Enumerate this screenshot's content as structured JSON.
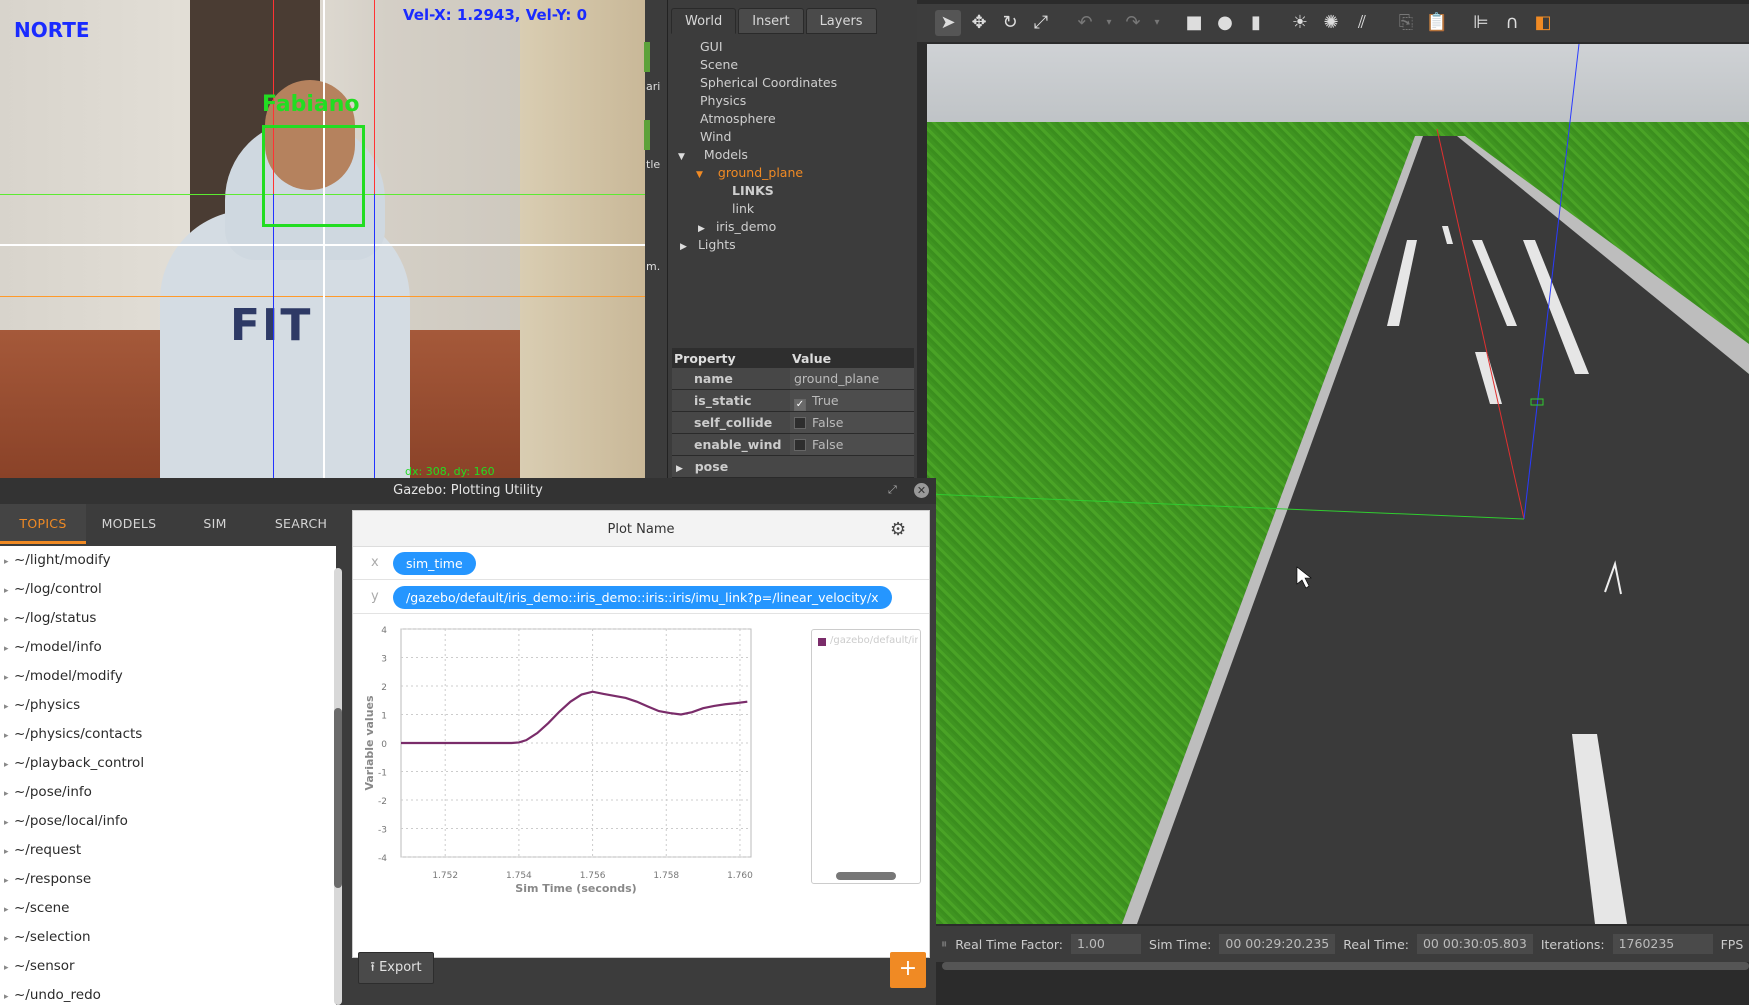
{
  "camera": {
    "overlay_label": "NORTE",
    "velocity_readout": "Vel-X: 1.2943, Vel-Y: 0",
    "face_label": "Fabiano",
    "shirt_print": "FIT",
    "offset_readout": "dx: 308, dy: 160"
  },
  "sliver": {
    "texts": [
      "ari",
      "tle",
      "m."
    ]
  },
  "world_panel": {
    "tabs": [
      "World",
      "Insert",
      "Layers"
    ],
    "tree": {
      "gui": "GUI",
      "scene": "Scene",
      "spherical": "Spherical Coordinates",
      "physics": "Physics",
      "atmosphere": "Atmosphere",
      "wind": "Wind",
      "models": "Models",
      "ground_plane": "ground_plane",
      "links": "LINKS",
      "link": "link",
      "iris_demo": "iris_demo",
      "lights": "Lights"
    },
    "properties": {
      "header_property": "Property",
      "header_value": "Value",
      "rows": [
        {
          "key": "name",
          "value": "ground_plane"
        },
        {
          "key": "is_static",
          "value": "True"
        },
        {
          "key": "self_collide",
          "value": "False"
        },
        {
          "key": "enable_wind",
          "value": "False"
        },
        {
          "key": "pose",
          "value": ""
        }
      ]
    },
    "accent_color": "#f08a24"
  },
  "status_bar": {
    "rtf_label": "Real Time Factor:",
    "rtf_value": "1.00",
    "sim_time_label": "Sim Time:",
    "sim_time_value": "00 00:29:20.235",
    "real_time_label": "Real Time:",
    "real_time_value": "00 00:30:05.803",
    "iterations_label": "Iterations:",
    "iterations_value": "1760235",
    "fps_label": "FPS"
  },
  "plot_window": {
    "title": "Gazebo: Plotting Utility",
    "tabs": [
      "TOPICS",
      "MODELS",
      "SIM",
      "SEARCH"
    ],
    "topics": [
      "~/light/modify",
      "~/log/control",
      "~/log/status",
      "~/model/info",
      "~/model/modify",
      "~/physics",
      "~/physics/contacts",
      "~/playback_control",
      "~/pose/info",
      "~/pose/local/info",
      "~/request",
      "~/response",
      "~/scene",
      "~/selection",
      "~/sensor",
      "~/undo_redo"
    ],
    "plot_name": "Plot Name",
    "x_label": "x",
    "y_label": "y",
    "x_variable": "sim_time",
    "y_variable": "/gazebo/default/iris_demo::iris_demo::iris::iris/imu_link?p=/linear_velocity/x",
    "legend_text": "/gazebo/default/iris",
    "export_label": "Export",
    "add_label": "+",
    "pill_color": "#2596ff",
    "series_color": "#7a2c6a"
  },
  "chart_data": {
    "type": "line",
    "xlabel": "Sim Time (seconds)",
    "ylabel": "Variable values",
    "xlim": [
      1.7508,
      1.7603
    ],
    "ylim": [
      -4,
      4
    ],
    "x_ticks": [
      1.752,
      1.754,
      1.756,
      1.758,
      1.76
    ],
    "y_ticks": [
      4,
      3,
      2,
      1,
      0,
      -1,
      -2,
      -3,
      -4
    ],
    "grid": true,
    "series": [
      {
        "x": [
          1.7508,
          1.7518,
          1.7528,
          1.7538,
          1.754,
          1.7542,
          1.7545,
          1.7548,
          1.7551,
          1.7554,
          1.7557,
          1.756,
          1.7563,
          1.7566,
          1.7569,
          1.7572,
          1.7575,
          1.7578,
          1.7581,
          1.7584,
          1.7587,
          1.759,
          1.7593,
          1.7596,
          1.7599,
          1.7602
        ],
        "values": [
          0,
          0,
          0,
          0,
          0.02,
          0.1,
          0.35,
          0.7,
          1.1,
          1.45,
          1.7,
          1.8,
          1.72,
          1.65,
          1.58,
          1.45,
          1.28,
          1.12,
          1.05,
          1.0,
          1.08,
          1.22,
          1.3,
          1.36,
          1.4,
          1.45
        ]
      }
    ]
  }
}
